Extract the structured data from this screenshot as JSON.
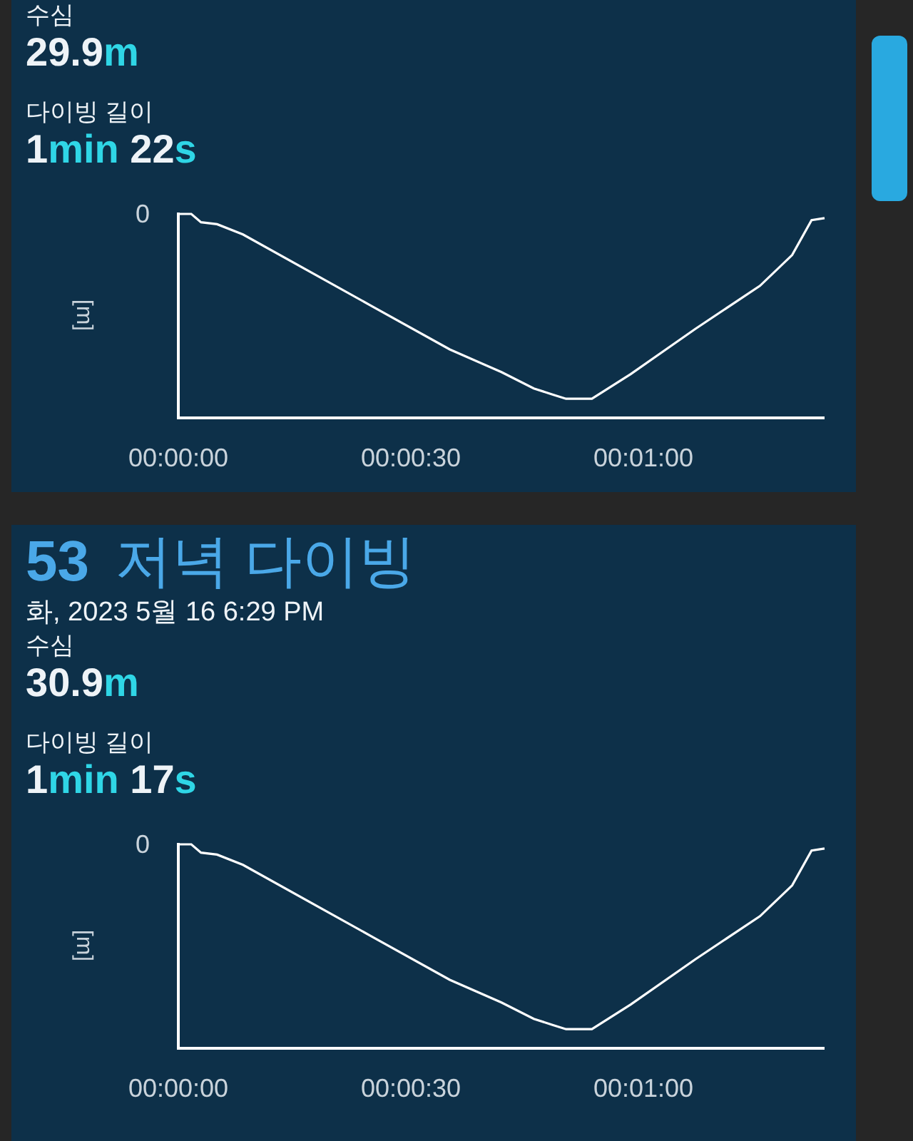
{
  "dives": [
    {
      "depth_label": "수심",
      "depth": [
        {
          "kind": "number",
          "text": "29.9"
        },
        {
          "kind": "unit",
          "text": "m"
        }
      ],
      "duration_label": "다이빙 길이",
      "duration": [
        {
          "kind": "number",
          "text": "1"
        },
        {
          "kind": "unit",
          "text": "min"
        },
        {
          "kind": "number",
          "text": " 22"
        },
        {
          "kind": "unit",
          "text": "s"
        }
      ],
      "chart": {
        "y_tick": "0",
        "y_unit": "[m]",
        "x_ticks": [
          "00:00:00",
          "00:00:30",
          "00:01:00"
        ]
      }
    },
    {
      "number": "53",
      "title": "저녁 다이빙",
      "date": "화, 2023 5월 16 6:29 PM",
      "depth_label": "수심",
      "depth": [
        {
          "kind": "number",
          "text": "30.9"
        },
        {
          "kind": "unit",
          "text": "m"
        }
      ],
      "duration_label": "다이빙 길이",
      "duration": [
        {
          "kind": "number",
          "text": "1"
        },
        {
          "kind": "unit",
          "text": "min"
        },
        {
          "kind": "number",
          "text": " 17"
        },
        {
          "kind": "unit",
          "text": "s"
        }
      ],
      "chart": {
        "y_tick": "0",
        "y_unit": "[m]",
        "x_ticks": [
          "00:00:00",
          "00:00:30",
          "00:01:00"
        ]
      }
    }
  ]
}
